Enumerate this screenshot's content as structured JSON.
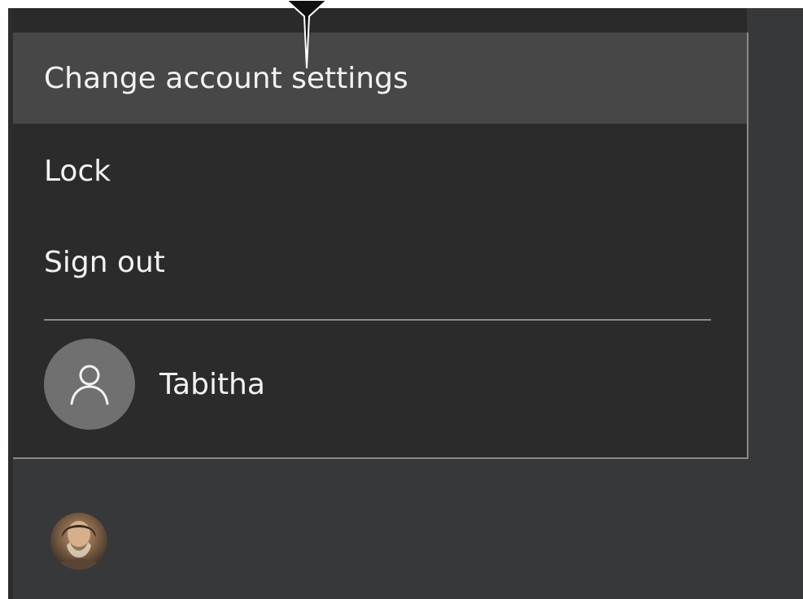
{
  "account_menu": {
    "items": [
      {
        "label": "Change account settings",
        "hover": true
      },
      {
        "label": "Lock"
      },
      {
        "label": "Sign out"
      }
    ],
    "user": {
      "name": "Tabitha",
      "icon": "person-icon"
    }
  },
  "start_menu": {
    "current_user_avatar_icon": "user-photo-avatar"
  },
  "colors": {
    "menu_background": "#2b2b2b",
    "hover_background": "#474747",
    "text": "#f2f2f2",
    "avatar_background": "#707070",
    "strip_background": "#36383a"
  }
}
